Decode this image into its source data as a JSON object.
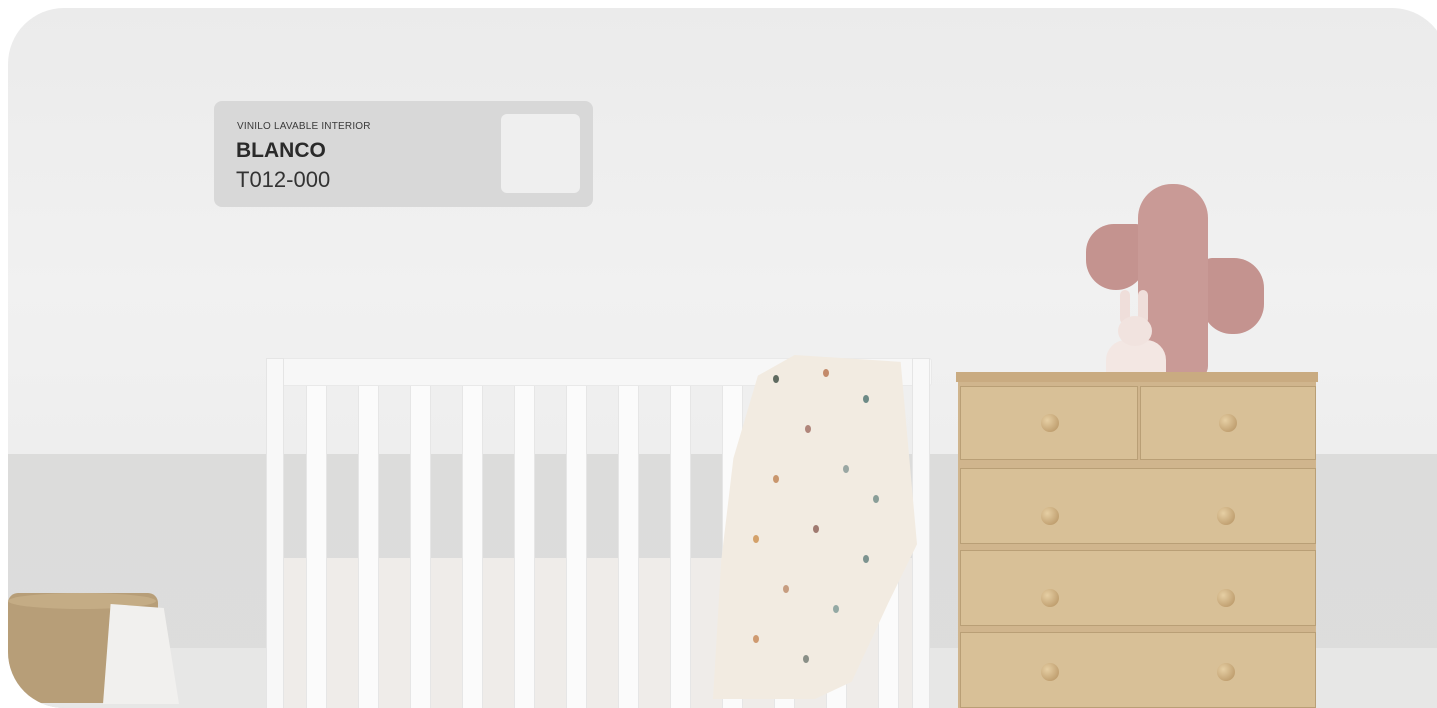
{
  "scene": {
    "description_free": true
  },
  "swatch_card": {
    "subtitle": "VINILO LAVABLE INTERIOR",
    "color_name": "BLANCO",
    "color_code": "T012-000",
    "chip_color": "#efefef",
    "card_color": "#d8d8d8"
  }
}
